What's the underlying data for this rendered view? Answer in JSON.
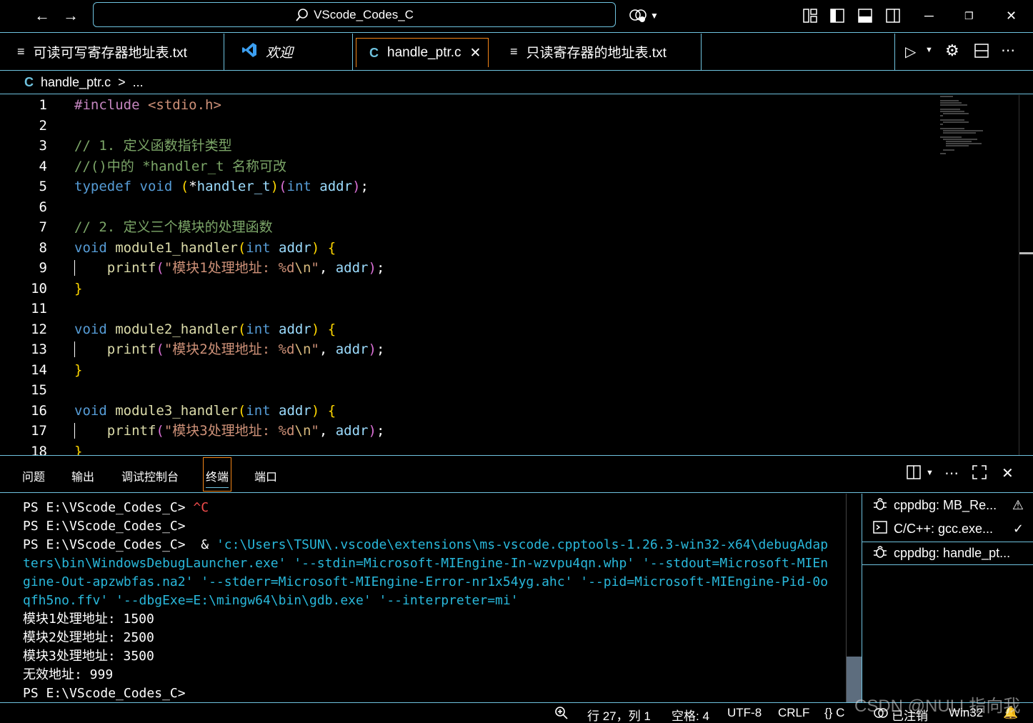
{
  "titlebar": {
    "search_text": "VScode_Codes_C",
    "icons": [
      "back-arrow-icon",
      "forward-arrow-icon",
      "search-icon",
      "copilot-icon",
      "chevron-down-icon",
      "customize-layout-icon",
      "toggle-primary-sidebar-icon",
      "toggle-panel-icon",
      "toggle-secondary-sidebar-icon",
      "minimize-icon",
      "restore-icon",
      "close-icon"
    ]
  },
  "tabs": [
    {
      "label": "可读可写寄存器地址表.txt",
      "icon": "text-file-icon"
    },
    {
      "label": "欢迎",
      "icon": "vscode-logo-icon"
    },
    {
      "label": "handle_ptr.c",
      "icon": "c-file-icon",
      "active": true
    },
    {
      "label": "只读寄存器的地址表.txt",
      "icon": "text-file-icon"
    }
  ],
  "tab_icons": {
    "text": "≡",
    "c": "C",
    "close": "✕"
  },
  "breadcrumb": {
    "file": "handle_ptr.c",
    "sep": ">",
    "more": "..."
  },
  "editor": {
    "line_numbers": [
      "1",
      "2",
      "3",
      "4",
      "5",
      "6",
      "7",
      "8",
      "9",
      "10",
      "11",
      "12",
      "13",
      "14",
      "15",
      "16",
      "17",
      "18"
    ]
  },
  "panel": {
    "tabs": [
      "问题",
      "输出",
      "调试控制台",
      "终端",
      "端口"
    ],
    "active_tab": "终端"
  },
  "terminal": {
    "prompt": "PS E:\\VScode_Codes_C>",
    "ctrl_c": "^C",
    "lines_cmd": [
      "'c:\\Users\\TSUN\\.vscode\\extensions\\ms-vscode.cpptools-1.26.3-win32-x64\\debugAdap",
      "ters\\bin\\WindowsDebugLauncher.exe' '--stdin=Microsoft-MIEngine-In-wzvpu4qn.whp' '--stdout=Microsoft-MIEn",
      "gine-Out-apzwbfas.na2' '--stderr=Microsoft-MIEngine-Error-nr1x54yg.ahc' '--pid=Microsoft-MIEngine-Pid-0o",
      "qfh5no.ffv' '--dbgExe=E:\\mingw64\\bin\\gdb.exe' '--interpreter=mi'"
    ],
    "amp": "&",
    "output": [
      "模块1处理地址: 1500",
      "模块2处理地址: 2500",
      "模块3处理地址: 3500",
      "无效地址: 999"
    ]
  },
  "terminal_list": [
    {
      "label": "cppdbg: MB_Re...",
      "status": "⚠",
      "icon": "debug-icon"
    },
    {
      "label": "C/C++: gcc.exe...",
      "status": "✓",
      "icon": "terminal-icon"
    },
    {
      "label": "cppdbg: handle_pt...",
      "status": "",
      "icon": "debug-icon"
    }
  ],
  "statusbar": {
    "position": "行 27，列 1",
    "spaces": "空格: 4",
    "encoding": "UTF-8",
    "eol": "CRLF",
    "language": "{} C",
    "account": "已注销",
    "platform": "Win32"
  },
  "watermark": "CSDN @NULL指向我",
  "colors": {
    "border": "#6fc3df",
    "active_border": "#f38518",
    "background": "#000000"
  }
}
